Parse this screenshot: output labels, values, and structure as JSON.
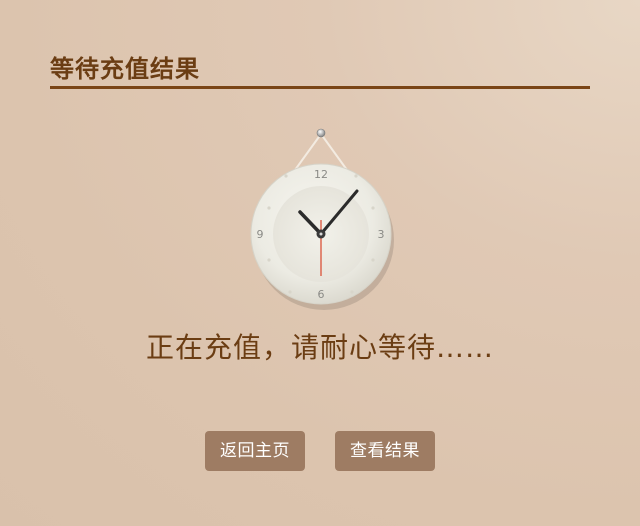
{
  "header": {
    "title": "等待充值结果"
  },
  "clock": {
    "icon": "wall-clock-icon",
    "numerals": {
      "top": "12",
      "right": "3",
      "bottom": "6",
      "left": "9"
    },
    "time_shown": "10:08"
  },
  "status": {
    "message": "正在充值，请耐心等待……"
  },
  "buttons": {
    "home_label": "返回主页",
    "result_label": "查看结果"
  },
  "colors": {
    "accent": "#7a4516",
    "title_text": "#6b3d13",
    "button_bg": "#9e7c63",
    "second_hand": "#d9452b"
  }
}
